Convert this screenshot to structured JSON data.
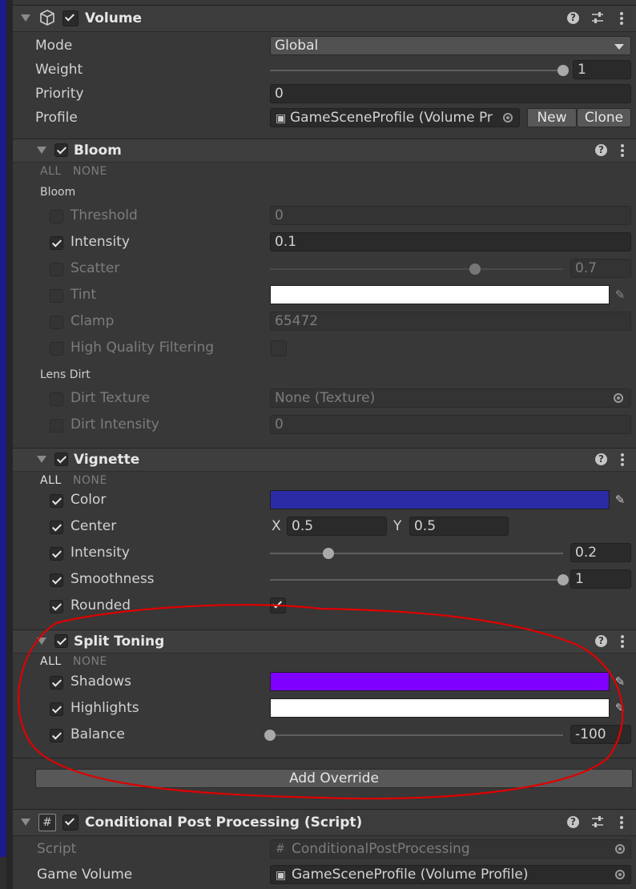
{
  "volume": {
    "title": "Volume",
    "mode_label": "Mode",
    "mode_value": "Global",
    "weight_label": "Weight",
    "weight_value": "1",
    "weight_level": 1,
    "priority_label": "Priority",
    "priority_value": "0",
    "profile_label": "Profile",
    "profile_value": "GameSceneProfile (Volume Pr",
    "new_label": "New",
    "clone_label": "Clone"
  },
  "bloom": {
    "title": "Bloom",
    "all": "ALL",
    "none": "NONE",
    "group_bloom": "Bloom",
    "group_lens": "Lens Dirt",
    "threshold_label": "Threshold",
    "threshold_value": "0",
    "intensity_label": "Intensity",
    "intensity_value": "0.1",
    "scatter_label": "Scatter",
    "scatter_value": "0.7",
    "scatter_level": 0.7,
    "tint_label": "Tint",
    "tint_color": "#ffffff",
    "clamp_label": "Clamp",
    "clamp_value": "65472",
    "hq_label": "High Quality Filtering",
    "dirt_texture_label": "Dirt Texture",
    "dirt_texture_value": "None (Texture)",
    "dirt_intensity_label": "Dirt Intensity",
    "dirt_intensity_value": "0"
  },
  "vignette": {
    "title": "Vignette",
    "all": "ALL",
    "none": "NONE",
    "color_label": "Color",
    "color_value": "#2b2ba6",
    "center_label": "Center",
    "center_x_label": "X",
    "center_x_value": "0.5",
    "center_y_label": "Y",
    "center_y_value": "0.5",
    "intensity_label": "Intensity",
    "intensity_value": "0.2",
    "intensity_level": 0.2,
    "smoothness_label": "Smoothness",
    "smoothness_value": "1",
    "smoothness_level": 1,
    "rounded_label": "Rounded"
  },
  "split_toning": {
    "title": "Split Toning",
    "all": "ALL",
    "none": "NONE",
    "shadows_label": "Shadows",
    "shadows_color": "#7f00ff",
    "highlights_label": "Highlights",
    "highlights_color": "#ffffff",
    "balance_label": "Balance",
    "balance_value": "-100",
    "balance_level": 0
  },
  "add_override_label": "Add Override",
  "script_component": {
    "title": "Conditional Post Processing (Script)",
    "script_label": "Script",
    "script_value": "ConditionalPostProcessing",
    "game_volume_label": "Game Volume",
    "game_volume_value": "GameSceneProfile (Volume Profile)"
  },
  "icons": [
    "cube-icon",
    "help-icon",
    "settings-sliders-icon",
    "more-icon",
    "eyedropper-icon",
    "object-picker-icon",
    "script-hash-icon",
    "profile-asset-icon"
  ],
  "colors": {
    "annotation": "#e00000",
    "panel": "#383838",
    "accent_blue": "#2b2ba6",
    "accent_purple": "#7f00ff"
  }
}
